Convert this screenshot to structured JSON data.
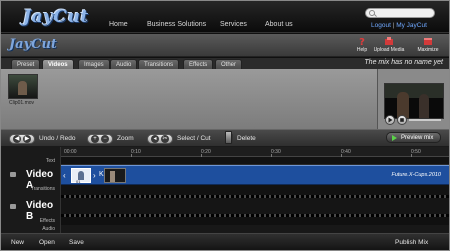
{
  "site": {
    "logo": "JayCut",
    "nav": [
      "Home",
      "Business Solutions",
      "Services",
      "About us"
    ],
    "account": {
      "logout": "Logout",
      "my": "My JayCut"
    }
  },
  "app": {
    "logo": "JayCut",
    "header_buttons": {
      "help": "Help",
      "upload": "Upload Media",
      "maximize": "Maximize"
    },
    "tabs": [
      "Preset",
      "Videos",
      "Images",
      "Audio",
      "Transitions",
      "Effects",
      "Other"
    ],
    "active_tab": "Videos",
    "mix_title": "The mix has no name yet"
  },
  "media": {
    "clip_label": "Clip01.mov"
  },
  "toolbar": {
    "undo_redo": "Undo / Redo",
    "zoom": "Zoom",
    "select_cut": "Select / Cut",
    "delete": "Delete",
    "preview_mix": "Preview mix",
    "undo_symbols": "◀",
    "redo_symbols": "▶"
  },
  "timeline": {
    "ticks": [
      "00:00",
      "0:10",
      "0:20",
      "0:30",
      "0:40",
      "0:50"
    ],
    "labels": {
      "text": "Text",
      "video_a": "Video A",
      "transitions": "Transitions",
      "video_b": "Video B",
      "effects": "Effects",
      "audio": "Audio"
    },
    "clip_a_number": "01",
    "watermark": "Future.X-Cups.2010"
  },
  "footer": {
    "new": "New",
    "open": "Open",
    "save": "Save",
    "publish": "Publish Mix"
  },
  "colors": {
    "accent_blue": "#1e4f9e",
    "link_blue": "#6fa8ff",
    "play_green": "#5bd24a"
  }
}
